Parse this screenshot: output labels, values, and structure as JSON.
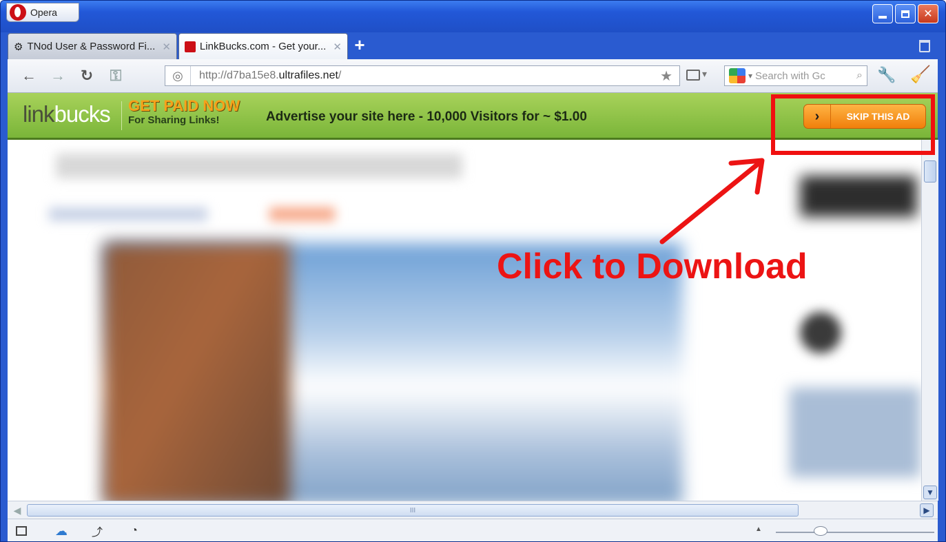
{
  "window": {
    "app_menu_label": "Opera"
  },
  "tabs": [
    {
      "title": "TNod User & Password Fi...",
      "active": false,
      "icon": "tnod-favicon-icon"
    },
    {
      "title": "LinkBucks.com - Get your...",
      "active": true,
      "icon": "opera-favicon-icon"
    }
  ],
  "toolbar": {
    "address_prefix": "http://d7ba15e8.",
    "address_domain": "ultrafiles.net",
    "address_suffix": "/",
    "search_placeholder": "Search with Gc"
  },
  "adbar": {
    "logo_link": "link",
    "logo_bucks": "bucks",
    "promo_line1": "GET PAID NOW",
    "promo_line2": "For Sharing Links!",
    "advert_text": "Advertise your site here - 10,000 Visitors for ~ $1.00",
    "skip_chevron": "›",
    "skip_label": "SKIP THIS AD",
    "accent_color": "#f58a12",
    "bar_color": "#8cc441"
  },
  "annotation": {
    "text": "Click to Download",
    "color": "#ec1414"
  },
  "scroll": {
    "hs_grip": "III"
  }
}
